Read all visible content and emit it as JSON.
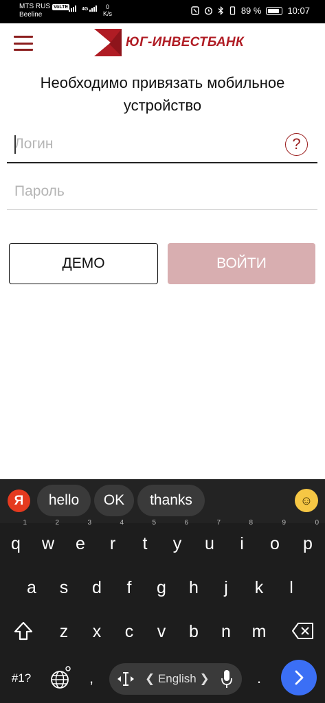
{
  "status_bar": {
    "carrier_primary": "MTS RUS",
    "volte": "VoLTE",
    "carrier_secondary": "Beeline",
    "network": "4G",
    "speed_value": "0",
    "speed_unit": "K/s",
    "battery_percent": "89 %",
    "time": "10:07"
  },
  "header": {
    "logo_text": "ЮГ-ИНВЕСТБАНК",
    "menu_icon": "hamburger-menu-icon",
    "brand_color": "#b01c24"
  },
  "page": {
    "title": "Необходимо привязать мобильное устройство"
  },
  "form": {
    "login_placeholder": "Логин",
    "password_placeholder": "Пароль",
    "help_symbol": "?"
  },
  "buttons": {
    "demo_label": "ДЕМО",
    "login_label": "ВОЙТИ",
    "login_color": "#d8aeb0"
  },
  "keyboard": {
    "brand_letter": "Я",
    "suggestions": [
      "hello",
      "OK",
      "thanks"
    ],
    "emoji_icon": "smiley-emoji-icon",
    "row1": [
      {
        "key": "q",
        "hint": "1"
      },
      {
        "key": "w",
        "hint": "2"
      },
      {
        "key": "e",
        "hint": "3"
      },
      {
        "key": "r",
        "hint": "4"
      },
      {
        "key": "t",
        "hint": "5"
      },
      {
        "key": "y",
        "hint": "6"
      },
      {
        "key": "u",
        "hint": "7"
      },
      {
        "key": "i",
        "hint": "8"
      },
      {
        "key": "o",
        "hint": "9"
      },
      {
        "key": "p",
        "hint": "0"
      }
    ],
    "row2": [
      "a",
      "s",
      "d",
      "f",
      "g",
      "h",
      "j",
      "k",
      "l"
    ],
    "row3": [
      "z",
      "x",
      "c",
      "v",
      "b",
      "n",
      "m"
    ],
    "symbols_label": "#1?",
    "comma": ",",
    "period": ".",
    "language_label": "❮ English ❯",
    "enter_color": "#3b6ff5"
  }
}
